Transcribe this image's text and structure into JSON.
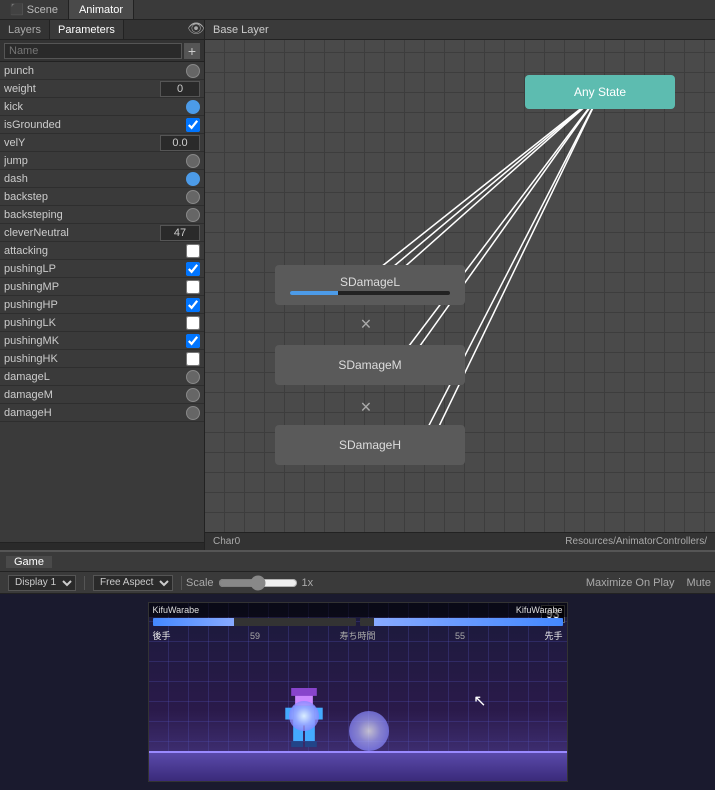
{
  "tabs": {
    "scene": "Scene",
    "animator": "Animator"
  },
  "leftPanel": {
    "tabs": [
      "Layers",
      "Parameters"
    ],
    "activeTab": "Parameters",
    "searchPlaceholder": "Name",
    "addButtonLabel": "+",
    "params": [
      {
        "name": "punch",
        "type": "toggle",
        "value": false
      },
      {
        "name": "weight",
        "type": "number",
        "value": "0"
      },
      {
        "name": "kick",
        "type": "toggle",
        "value": true
      },
      {
        "name": "isGrounded",
        "type": "checkbox",
        "value": true
      },
      {
        "name": "velY",
        "type": "number",
        "value": "0.0"
      },
      {
        "name": "jump",
        "type": "toggle",
        "value": false
      },
      {
        "name": "dash",
        "type": "toggle",
        "value": true
      },
      {
        "name": "backstep",
        "type": "toggle",
        "value": false
      },
      {
        "name": "backsteping",
        "type": "toggle",
        "value": false
      },
      {
        "name": "cleverNeutral",
        "type": "number",
        "value": "47"
      },
      {
        "name": "attacking",
        "type": "checkbox",
        "value": false
      },
      {
        "name": "pushingLP",
        "type": "checkbox",
        "value": true
      },
      {
        "name": "pushingMP",
        "type": "checkbox",
        "value": false
      },
      {
        "name": "pushingHP",
        "type": "checkbox",
        "value": true
      },
      {
        "name": "pushingLK",
        "type": "checkbox",
        "value": false
      },
      {
        "name": "pushingMK",
        "type": "checkbox",
        "value": true
      },
      {
        "name": "pushingHK",
        "type": "checkbox",
        "value": false
      },
      {
        "name": "damageL",
        "type": "toggle",
        "value": false
      },
      {
        "name": "damageM",
        "type": "toggle",
        "value": false
      },
      {
        "name": "damageH",
        "type": "toggle",
        "value": false
      }
    ]
  },
  "animatorPanel": {
    "title": "Base Layer",
    "statusLeft": "Char0",
    "statusRight": "Resources/AnimatorControllers/"
  },
  "stateNodes": {
    "anyState": "Any State",
    "sdamageL": "SDamageL",
    "sdamageM": "SDamageM",
    "sdamageH": "SDamageH"
  },
  "gamePanel": {
    "tab": "Game",
    "displayLabel": "Display 1",
    "aspectLabel": "Free Aspect",
    "scaleLabel": "Scale",
    "scaleValue": "1x",
    "maximizeLabel": "Maximize On Play",
    "muteLabel": "Mute",
    "player1Name": "KifuWarabe",
    "player2Name": "KifuWarabe",
    "timerLabel": "寿ち時間",
    "p1Label": "後手",
    "p2Label": "先手",
    "p1Score": "59",
    "p2Score": "55",
    "scoreValue": "93"
  }
}
